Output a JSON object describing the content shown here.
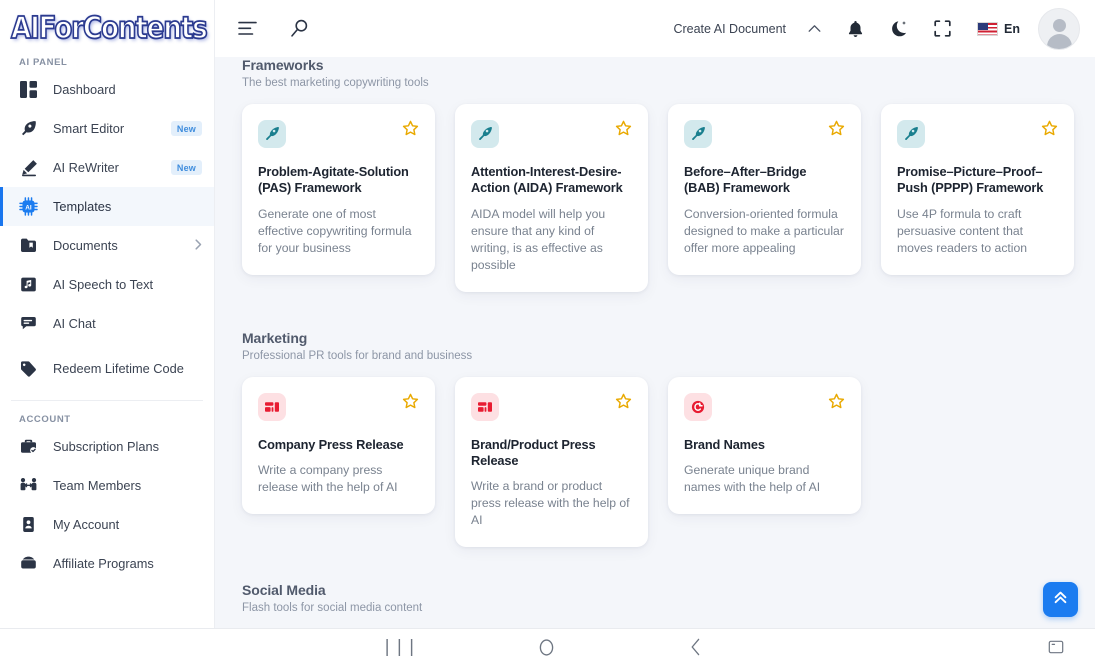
{
  "brand": {
    "logo_text": "AIForContents"
  },
  "sidebar": {
    "section_ai_label": "AI PANEL",
    "section_account_label": "ACCOUNT",
    "ai_items": [
      {
        "label": "Dashboard",
        "icon": "dashboard-icon",
        "badge": "",
        "chevron": false,
        "active": false
      },
      {
        "label": "Smart Editor",
        "icon": "feather-pen-icon",
        "badge": "New",
        "chevron": false,
        "active": false
      },
      {
        "label": "AI ReWriter",
        "icon": "pencil-icon",
        "badge": "New",
        "chevron": false,
        "active": false
      },
      {
        "label": "Templates",
        "icon": "ai-chip-icon",
        "badge": "",
        "chevron": false,
        "active": true
      },
      {
        "label": "Documents",
        "icon": "documents-folder-icon",
        "badge": "",
        "chevron": true,
        "active": false
      },
      {
        "label": "AI Speech to Text",
        "icon": "folder-music-icon",
        "badge": "",
        "chevron": false,
        "active": false
      },
      {
        "label": "AI Chat",
        "icon": "chat-bubble-icon",
        "badge": "",
        "chevron": false,
        "active": false
      },
      {
        "label": "Redeem Lifetime Code",
        "icon": "tag-icon",
        "badge": "",
        "chevron": false,
        "active": false
      }
    ],
    "account_items": [
      {
        "label": "Subscription Plans",
        "icon": "briefcase-check-icon"
      },
      {
        "label": "Team Members",
        "icon": "team-members-icon"
      },
      {
        "label": "My Account",
        "icon": "id-card-icon"
      },
      {
        "label": "Affiliate Programs",
        "icon": "handshake-icon"
      }
    ]
  },
  "header": {
    "menu_icon": "hamburger-menu-icon",
    "search_icon": "search-icon",
    "create_document_label": "Create AI Document",
    "chevron_icon": "chevron-up-icon",
    "bell_icon": "notification-bell-icon",
    "dark_mode_icon": "moon-dark-mode-icon",
    "fullscreen_icon": "fullscreen-icon",
    "language_code": "En",
    "language_flag": "us-flag-icon",
    "avatar_icon": "user-avatar"
  },
  "sections": [
    {
      "title": "Frameworks",
      "subtitle": "The best marketing copywriting tools",
      "cards": [
        {
          "title": "Problem-Agitate-Solution (PAS) Framework",
          "desc": "Generate one of most effective copywriting formula for your business",
          "icon": "fountain-pen-icon",
          "icon_style": "ico-pen",
          "star": "star-outline-icon"
        },
        {
          "title": "Attention-Interest-Desire-Action (AIDA) Framework",
          "desc": "AIDA model will help you ensure that any kind of writing, is as effective as possible",
          "icon": "fountain-pen-icon",
          "icon_style": "ico-pen",
          "star": "star-outline-icon"
        },
        {
          "title": "Before–After–Bridge (BAB) Framework",
          "desc": "Conversion-oriented formula designed to make a particular offer more appealing",
          "icon": "fountain-pen-icon",
          "icon_style": "ico-pen",
          "star": "star-outline-icon"
        },
        {
          "title": "Promise–Picture–Proof–Push (PPPP) Framework",
          "desc": "Use 4P formula to craft persuasive content that moves readers to action",
          "icon": "fountain-pen-icon",
          "icon_style": "ico-pen",
          "star": "star-outline-icon"
        }
      ]
    },
    {
      "title": "Marketing",
      "subtitle": "Professional PR tools for brand and business",
      "cards": [
        {
          "title": "Company Press Release",
          "desc": "Write a company press release with the help of AI",
          "icon": "press-release-icon",
          "icon_style": "ico-press",
          "star": "star-outline-icon"
        },
        {
          "title": "Brand/Product Press Release",
          "desc": "Write a brand or product press release with the help of AI",
          "icon": "press-release-icon",
          "icon_style": "ico-press",
          "star": "star-outline-icon"
        },
        {
          "title": "Brand Names",
          "desc": "Generate unique brand names with the help of AI",
          "icon": "brand-badge-icon",
          "icon_style": "ico-press",
          "star": "star-outline-icon"
        }
      ]
    },
    {
      "title": "Social Media",
      "subtitle": "Flash tools for social media content",
      "cards": []
    }
  ],
  "fab": {
    "icon": "double-chevron-up-icon"
  },
  "android_nav": {
    "recents": "|||",
    "recents_icon": "recents-icon",
    "home_icon": "home-icon",
    "back_icon": "back-icon",
    "keyboard_icon": "minimize-keyboard-icon"
  },
  "colors": {
    "accent": "#1976ee",
    "page_bg": "#f4f6fa",
    "star": "#e9a900",
    "pen_icon": "#1a7f8e",
    "press_icon": "#e81c32"
  }
}
